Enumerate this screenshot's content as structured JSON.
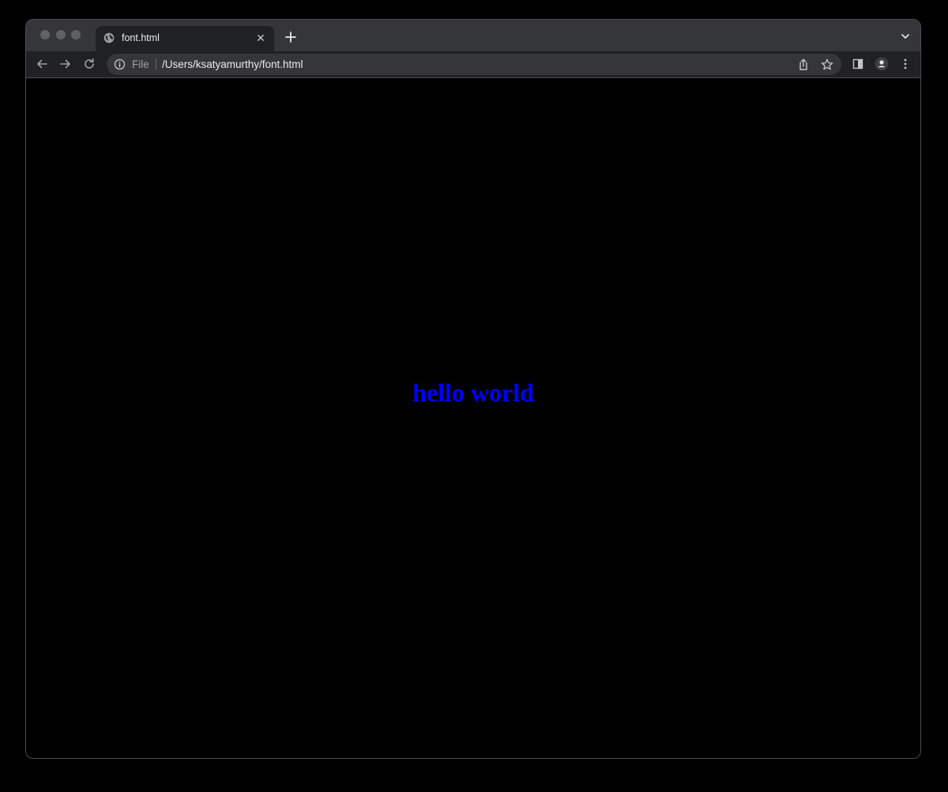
{
  "window": {
    "tab": {
      "title": "font.html",
      "close_icon": "close-icon",
      "favicon": "globe-icon"
    },
    "new_tab_icon": "plus-icon",
    "tab_search_icon": "chevron-down-icon"
  },
  "toolbar": {
    "back_icon": "arrow-left-icon",
    "forward_icon": "arrow-right-icon",
    "reload_icon": "reload-icon",
    "omnibox": {
      "scheme_label": "File",
      "url": "/Users/ksatyamurthy/font.html",
      "info_icon": "info-icon",
      "share_icon": "share-icon",
      "bookmark_icon": "star-icon"
    },
    "side_panel_icon": "side-panel-icon",
    "profile_icon": "profile-icon",
    "menu_icon": "kebab-menu-icon"
  },
  "page": {
    "heading": "hello world",
    "heading_color": "#0000ff",
    "background_color": "#000000"
  }
}
